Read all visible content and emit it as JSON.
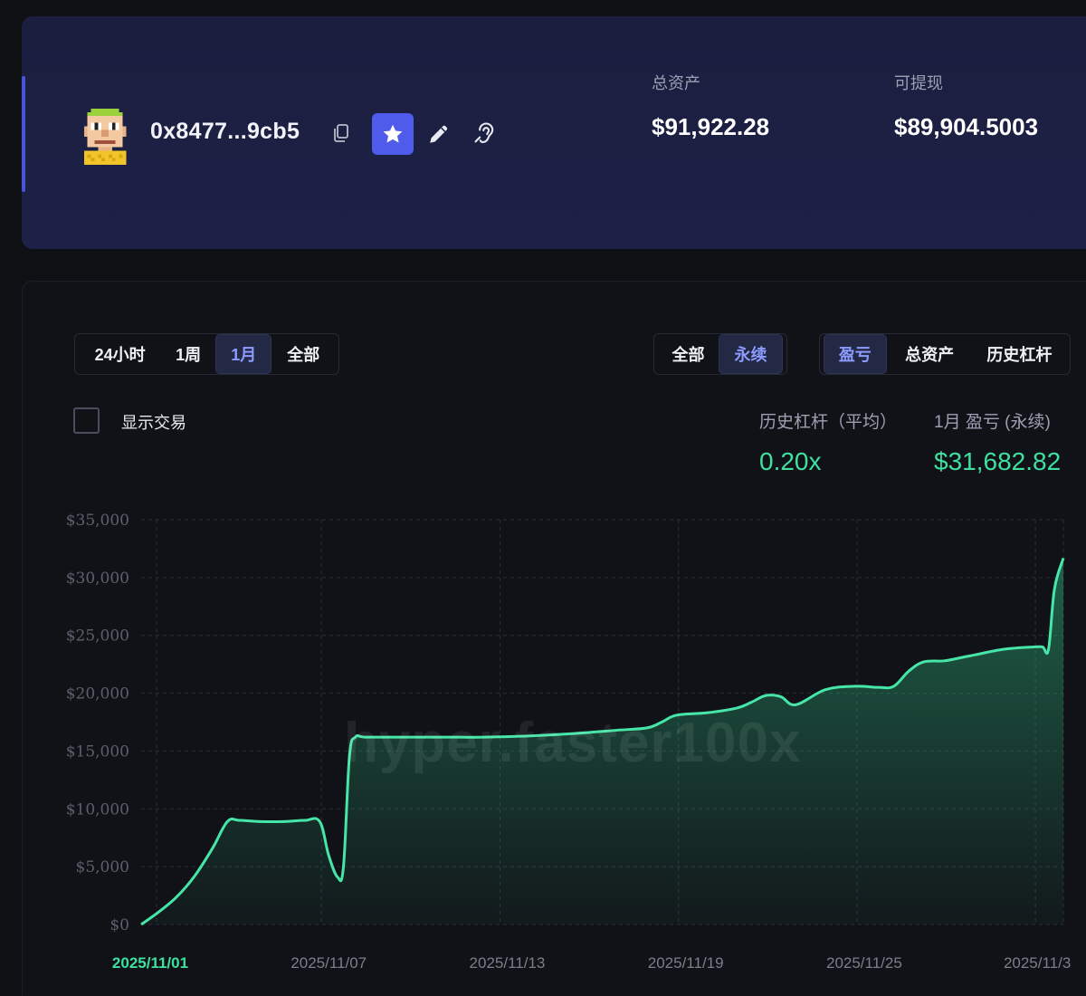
{
  "header": {
    "address": "0x8477...9cb5",
    "total_assets_label": "总资产",
    "total_assets_value": "$91,922.28",
    "withdrawable_label": "可提现",
    "withdrawable_value": "$89,904.5003"
  },
  "controls": {
    "range_tabs": [
      "24小时",
      "1周",
      "1月",
      "全部"
    ],
    "range_active": "1月",
    "market_tabs": [
      "全部",
      "永续"
    ],
    "market_active": "永续",
    "metric_tabs": [
      "盈亏",
      "总资产",
      "历史杠杆"
    ],
    "metric_active": "盈亏",
    "show_trades_label": "显示交易"
  },
  "metrics": {
    "leverage_label": "历史杠杆（平均）",
    "leverage_value": "0.20x",
    "pnl_label": "1月 盈亏 (永续)",
    "pnl_value": "$31,682.82"
  },
  "watermark": "hyper.faster100x",
  "colors": {
    "accent": "#4f5bea",
    "positive": "#3ee0a0",
    "line": "#46e6a8"
  },
  "chart_data": {
    "type": "area",
    "title": "",
    "xlabel": "",
    "ylabel": "",
    "ylim": [
      0,
      35000
    ],
    "y_ticks": [
      "$0",
      "$5,000",
      "$10,000",
      "$15,000",
      "$20,000",
      "$25,000",
      "$30,000",
      "$35,000"
    ],
    "x_ticks": [
      "2025/11/01",
      "2025/11/07",
      "2025/11/13",
      "2025/11/19",
      "2025/11/25",
      "2025/11/3"
    ],
    "x_tick_days": [
      0,
      6,
      12,
      18,
      24,
      30
    ],
    "highlight_x_tick": "2025/11/01",
    "series": [
      {
        "x": [
          0,
          0.6,
          1.2,
          1.8,
          2.4,
          2.9,
          3.3,
          4.0,
          4.8,
          5.5,
          6.0,
          6.3,
          6.6,
          6.8,
          7.0,
          7.2,
          7.5,
          8.5,
          10.0,
          11.5,
          13.0,
          14.5,
          16.0,
          17.0,
          17.5,
          18.0,
          19.0,
          20.0,
          20.5,
          21.0,
          21.5,
          22.0,
          23.0,
          24.0,
          24.8,
          25.3,
          25.8,
          26.3,
          27.0,
          27.6,
          28.0,
          29.0,
          30.0,
          30.3,
          30.5,
          30.7,
          31.0
        ],
        "y": [
          0,
          1100,
          2400,
          4200,
          6600,
          8900,
          9000,
          8900,
          8900,
          9000,
          8900,
          6000,
          4100,
          5000,
          14500,
          16200,
          16200,
          16200,
          16200,
          16200,
          16300,
          16500,
          16800,
          17000,
          17500,
          18100,
          18300,
          18700,
          19200,
          19800,
          19700,
          19000,
          20300,
          20600,
          20500,
          20600,
          21900,
          22700,
          22800,
          23100,
          23300,
          23800,
          24000,
          24000,
          23800,
          29000,
          31682
        ]
      }
    ]
  }
}
